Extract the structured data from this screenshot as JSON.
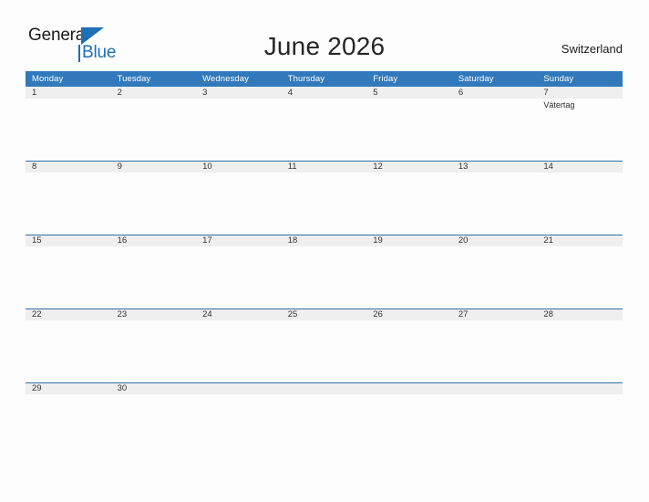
{
  "logo": {
    "word_one": "General",
    "word_two": "Blue",
    "triangle_icon": "triangle-icon",
    "accent_color": "#1f6fb5"
  },
  "header": {
    "title": "June 2026",
    "country": "Switzerland"
  },
  "theme": {
    "header_blue": "#3179ba",
    "band_gray": "#efefef",
    "rule_blue": "#2f6fa8",
    "page_background": "#fdfdfd",
    "text_dark": "#333333"
  },
  "calendar": {
    "month": "June",
    "year": "2026",
    "weekdays": [
      "Monday",
      "Tuesday",
      "Wednesday",
      "Thursday",
      "Friday",
      "Saturday",
      "Sunday"
    ],
    "weeks": [
      [
        {
          "day": "1",
          "event": ""
        },
        {
          "day": "2",
          "event": ""
        },
        {
          "day": "3",
          "event": ""
        },
        {
          "day": "4",
          "event": ""
        },
        {
          "day": "5",
          "event": ""
        },
        {
          "day": "6",
          "event": ""
        },
        {
          "day": "7",
          "event": "Vätertag"
        }
      ],
      [
        {
          "day": "8",
          "event": ""
        },
        {
          "day": "9",
          "event": ""
        },
        {
          "day": "10",
          "event": ""
        },
        {
          "day": "11",
          "event": ""
        },
        {
          "day": "12",
          "event": ""
        },
        {
          "day": "13",
          "event": ""
        },
        {
          "day": "14",
          "event": ""
        }
      ],
      [
        {
          "day": "15",
          "event": ""
        },
        {
          "day": "16",
          "event": ""
        },
        {
          "day": "17",
          "event": ""
        },
        {
          "day": "18",
          "event": ""
        },
        {
          "day": "19",
          "event": ""
        },
        {
          "day": "20",
          "event": ""
        },
        {
          "day": "21",
          "event": ""
        }
      ],
      [
        {
          "day": "22",
          "event": ""
        },
        {
          "day": "23",
          "event": ""
        },
        {
          "day": "24",
          "event": ""
        },
        {
          "day": "25",
          "event": ""
        },
        {
          "day": "26",
          "event": ""
        },
        {
          "day": "27",
          "event": ""
        },
        {
          "day": "28",
          "event": ""
        }
      ],
      [
        {
          "day": "29",
          "event": ""
        },
        {
          "day": "30",
          "event": ""
        },
        {
          "day": "",
          "event": ""
        },
        {
          "day": "",
          "event": ""
        },
        {
          "day": "",
          "event": ""
        },
        {
          "day": "",
          "event": ""
        },
        {
          "day": "",
          "event": ""
        }
      ]
    ]
  }
}
